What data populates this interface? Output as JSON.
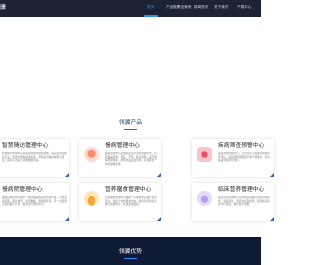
{
  "header": {
    "logo_text": "康",
    "nav": [
      {
        "label": "首页",
        "active": true
      },
      {
        "label": "产品服务"
      },
      {
        "label": "产品案例"
      },
      {
        "label": "新闻资讯"
      },
      {
        "label": "关于我们"
      },
      {
        "label": "下载中心"
      }
    ]
  },
  "products": {
    "title": "领翼产品",
    "cards": [
      {
        "title": "智慧随访管理中心",
        "desc": "智慧随访管理中心是专业的随访管理系统，院后患者的随访记录、管理计划和健康档案，帮助提高随访效率与质量，医院与患者之间的健康连接。",
        "icon_color": "#d7e6ff"
      },
      {
        "title": "慢病管理中心",
        "desc": "慢病管理中心是慢病患者全流程管理平台，包括慢病筛查、评估、干预、随访管理，提升慢病管理效率，降低并发症发生率，实现医患一体化健康管理。",
        "icon_color": "#ffd9cf"
      },
      {
        "title": "疾病筛查预警中心",
        "desc": "疾病筛查预警中心，针对高危人群进行智能筛查评估，提供风险预警及早期干预建议，助力疾病早发现早治疗。",
        "icon_color": "#f6c3c8"
      },
      {
        "title": "慢病院管理中心",
        "desc": "慢病院管理中心提供一站式慢病院运营管理方案，包含患者管理、医护协同、质控数据、随访服务等，另一方面通过远程医疗方式，提高诊疗服务水平。",
        "icon_color": "#dfe6f5"
      },
      {
        "title": "营养膳食管理中心",
        "desc": "营养膳食管理中心根据个人健康状况进行营养评估，制定个性化膳食方案，提供营养知识宣教与饮食指导，促进患者康复。",
        "icon_color": "#ffe4b8"
      },
      {
        "title": "临床营养管理中心",
        "desc": "临床营养管理中心为住院患者提供营养风险筛查、营养评估、营养支持及监测，规范临床营养诊疗流程，提升医疗质量。",
        "icon_color": "#e3dcf7"
      }
    ]
  },
  "advantages": {
    "title": "领翼优势"
  }
}
